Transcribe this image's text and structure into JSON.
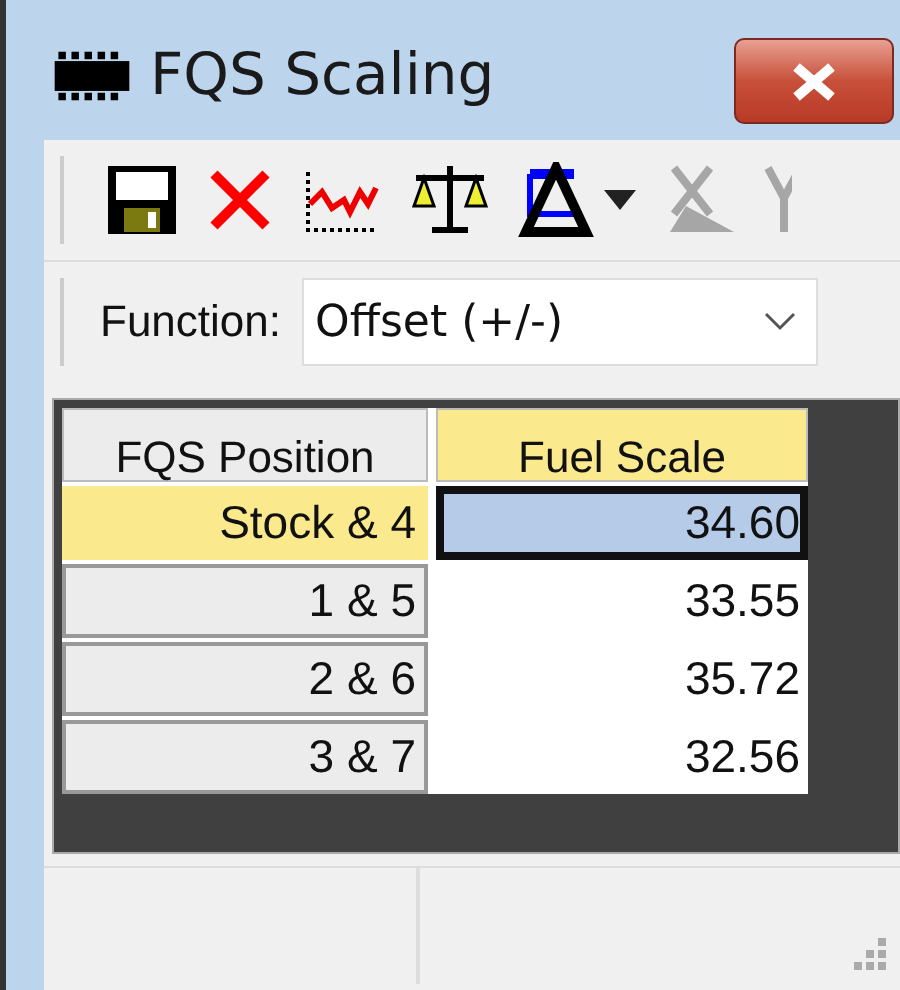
{
  "window": {
    "title": "FQS Scaling"
  },
  "toolbar": [
    {
      "kind": "save",
      "disabled": false
    },
    {
      "kind": "delete",
      "disabled": false
    },
    {
      "kind": "graph",
      "disabled": false
    },
    {
      "kind": "balance",
      "disabled": false
    },
    {
      "kind": "range",
      "disabled": false
    },
    {
      "kind": "dropdown",
      "disabled": false
    },
    {
      "kind": "x-axis",
      "disabled": true
    },
    {
      "kind": "y-axis",
      "disabled": true
    }
  ],
  "function": {
    "label": "Function:",
    "value": "Offset (+/-)"
  },
  "table": {
    "columns": [
      {
        "label": "FQS Position",
        "selected": false
      },
      {
        "label": "Fuel Scale",
        "selected": true
      }
    ],
    "rows": [
      {
        "position": "Stock & 4",
        "value": "34.60",
        "selected": true
      },
      {
        "position": "1 & 5",
        "value": "33.55",
        "selected": false
      },
      {
        "position": "2 & 6",
        "value": "35.72",
        "selected": false
      },
      {
        "position": "3 & 7",
        "value": "32.56",
        "selected": false
      }
    ]
  }
}
